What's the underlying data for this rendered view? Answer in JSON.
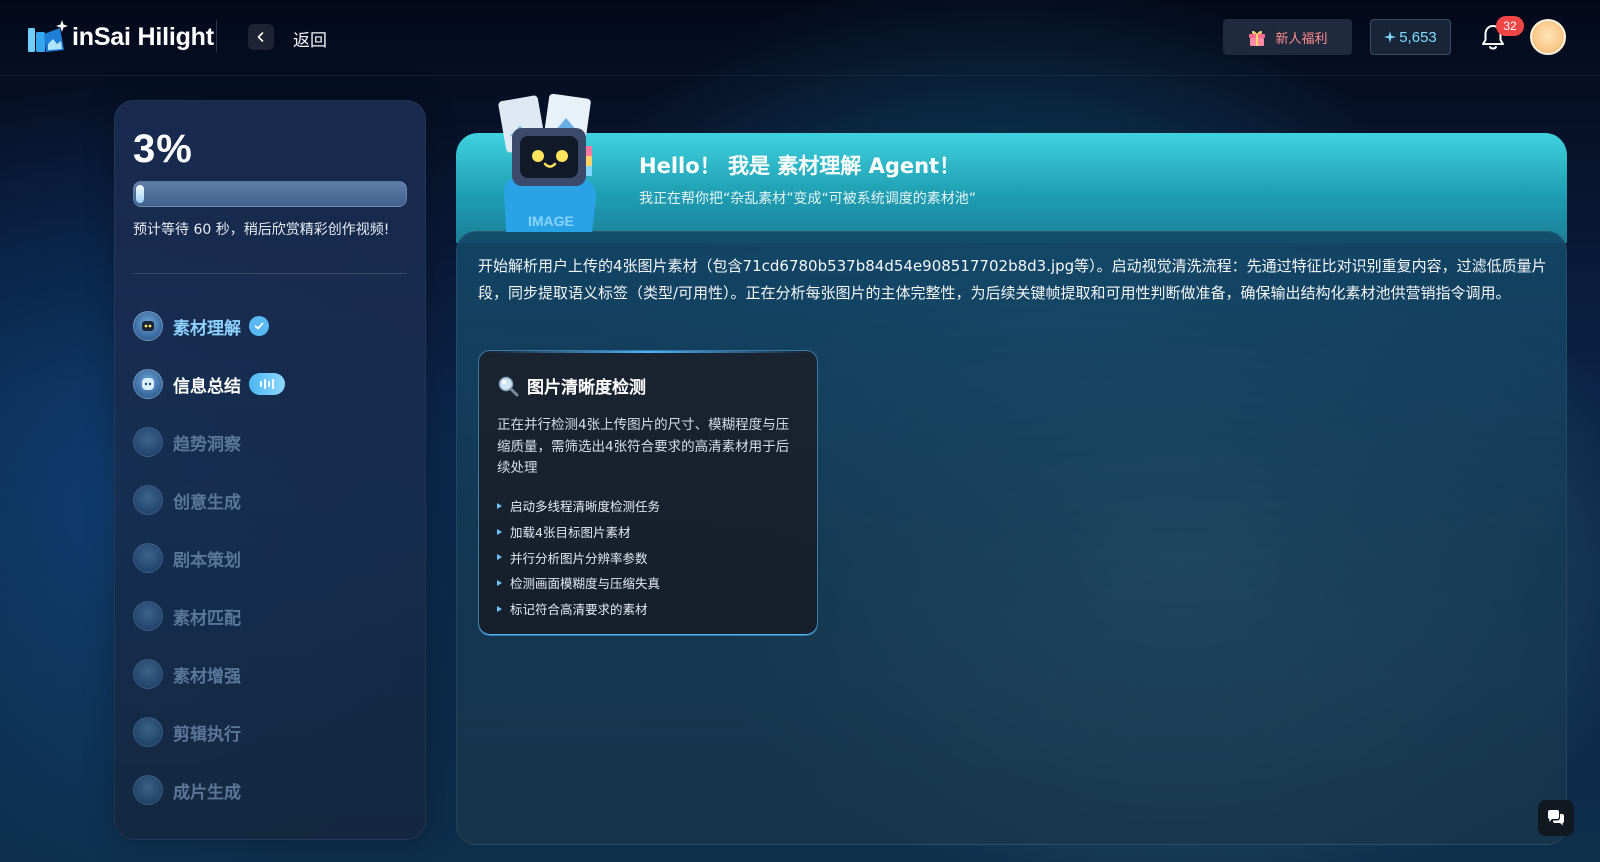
{
  "header": {
    "logo_text": "inSai Hilight",
    "back_label": "返回",
    "gift_label": "新人福利",
    "credits": "5,653",
    "notification_count": "32"
  },
  "sidebar": {
    "progress_percent": "3%",
    "progress_value": 0.03,
    "wait_text": "预计等待 60 秒，稍后欣赏精彩创作视频!",
    "steps": [
      {
        "label": "素材理解",
        "status": "done"
      },
      {
        "label": "信息总结",
        "status": "active"
      },
      {
        "label": "趋势洞察",
        "status": "pending"
      },
      {
        "label": "创意生成",
        "status": "pending"
      },
      {
        "label": "剧本策划",
        "status": "pending"
      },
      {
        "label": "素材匹配",
        "status": "pending"
      },
      {
        "label": "素材增强",
        "status": "pending"
      },
      {
        "label": "剪辑执行",
        "status": "pending"
      },
      {
        "label": "成片生成",
        "status": "pending"
      }
    ]
  },
  "main": {
    "hero_title": "Hello！ 我是 素材理解 Agent！",
    "hero_subtitle": "我正在帮你把“杂乱素材”变成“可被系统调度的素材池”",
    "description": "开始解析用户上传的4张图片素材（包含71cd6780b537b84d54e908517702b8d3.jpg等）。启动视觉清洗流程：先通过特征比对识别重复内容，过滤低质量片段，同步提取语义标签（类型/可用性）。正在分析每张图片的主体完整性，为后续关键帧提取和可用性判断做准备，确保输出结构化素材池供营销指令调用。",
    "card": {
      "title": "图片清晰度检测",
      "description": "正在并行检测4张上传图片的尺寸、模糊程度与压缩质量，需筛选出4张符合要求的高清素材用于后续处理",
      "items": [
        "启动多线程清晰度检测任务",
        "加载4张目标图片素材",
        "并行分析图片分辨率参数",
        "检测画面模糊度与压缩失真",
        "标记符合高清要求的素材"
      ]
    }
  },
  "colors": {
    "accent": "#4ab6ff",
    "hero": "#3fd2de",
    "badge_red": "#f04646"
  }
}
